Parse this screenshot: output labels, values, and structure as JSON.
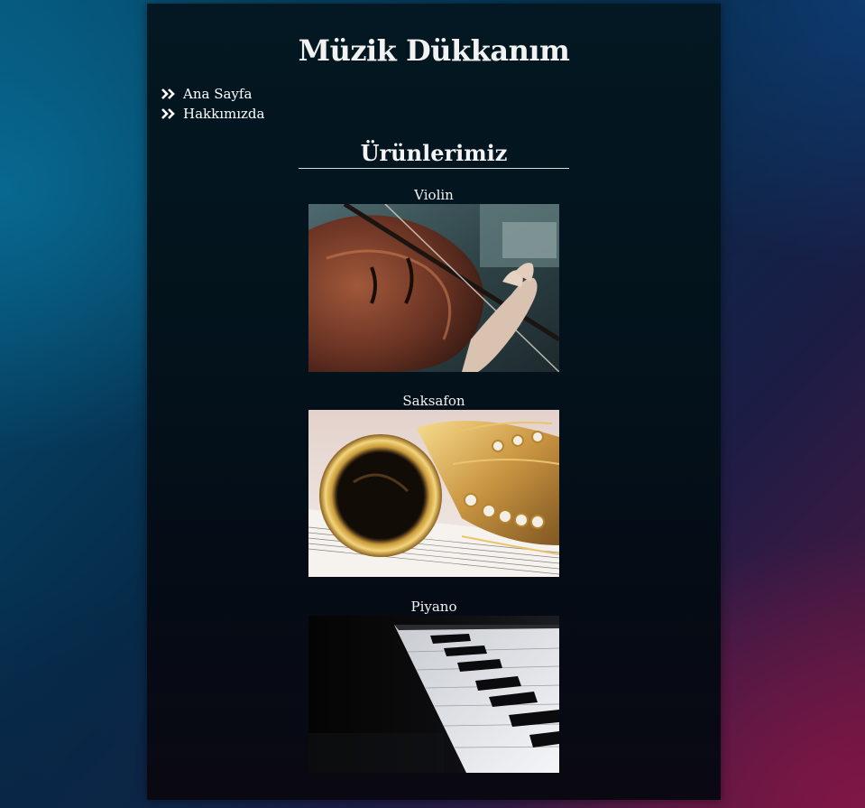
{
  "site": {
    "title": "Müzik Dükkanım"
  },
  "nav": {
    "items": [
      {
        "label": "Ana Sayfa",
        "icon": "double-chevron-right-icon"
      },
      {
        "label": "Hakkımızda",
        "icon": "double-chevron-right-icon"
      }
    ]
  },
  "products": {
    "heading": "Ürünlerimiz",
    "items": [
      {
        "name": "Violin",
        "image": "violin-photo"
      },
      {
        "name": "Saksafon",
        "image": "saxophone-photo"
      },
      {
        "name": "Piyano",
        "image": "piano-photo"
      }
    ]
  },
  "colors": {
    "panel": "#03121b",
    "text": "#f2f2f2",
    "rule": "#d9d9d9"
  }
}
